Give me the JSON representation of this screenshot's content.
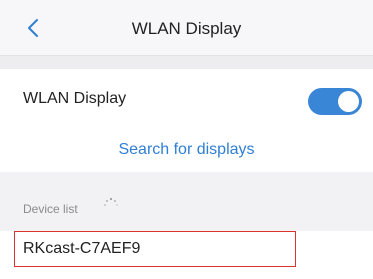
{
  "header": {
    "title": "WLAN Display"
  },
  "wlan": {
    "label": "WLAN Display",
    "enabled": true,
    "search_label": "Search for displays"
  },
  "devices": {
    "section_label": "Device list",
    "items": [
      {
        "name": "RKcast-C7AEF9"
      }
    ]
  },
  "colors": {
    "accent": "#3a86d6",
    "link": "#2f7fd4",
    "highlight": "#d9342b"
  },
  "icons": {
    "back": "chevron-left-icon",
    "spinner": "loading-spinner-icon"
  }
}
